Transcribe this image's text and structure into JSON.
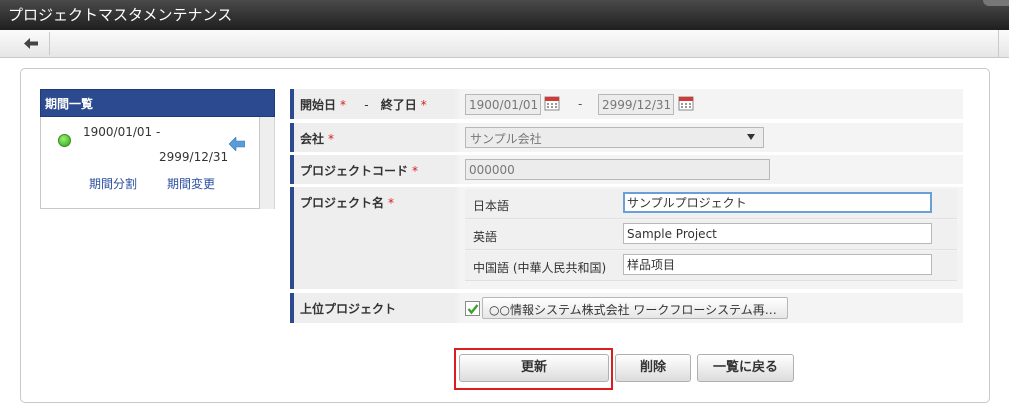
{
  "window": {
    "title": "プロジェクトマスタメンテナンス"
  },
  "period_list": {
    "header": "期間一覧",
    "items": [
      {
        "from": "1900/01/01 -",
        "to": "2999/12/31"
      }
    ],
    "split_link": "期間分割",
    "change_link": "期間変更"
  },
  "form": {
    "period": {
      "start_label": "開始日",
      "separator": "-",
      "end_label": "終了日",
      "required_mark": "*",
      "start_value": "1900/01/01",
      "range_separator": "-",
      "end_value": "2999/12/31"
    },
    "company": {
      "label": "会社",
      "required_mark": "*",
      "value": "サンプル会社"
    },
    "project_code": {
      "label": "プロジェクトコード",
      "required_mark": "*",
      "value": "000000"
    },
    "project_name": {
      "label": "プロジェクト名",
      "required_mark": "*",
      "languages": [
        {
          "label": "日本語",
          "value": "サンプルプロジェクト"
        },
        {
          "label": "英語",
          "value": "Sample Project"
        },
        {
          "label": "中国語 (中華人民共和国)",
          "value": "样品项目"
        }
      ]
    },
    "parent_project": {
      "label": "上位プロジェクト",
      "checked": true,
      "value": "○○情報システム株式会社 ワークフローシステム再…"
    }
  },
  "buttons": {
    "update": "更新",
    "delete": "削除",
    "back_to_list": "一覧に戻る"
  },
  "colors": {
    "header_blue": "#2b4a8f",
    "required_red": "#d12020",
    "highlight_red": "#d81e1e",
    "active_green": "#2aa60c"
  },
  "icons": {
    "back": "left-arrow-icon",
    "calendar": "calendar-icon",
    "status": "green-status-icon",
    "select_period": "left-arrow-blue-icon",
    "checkbox": "checkmark-icon"
  }
}
